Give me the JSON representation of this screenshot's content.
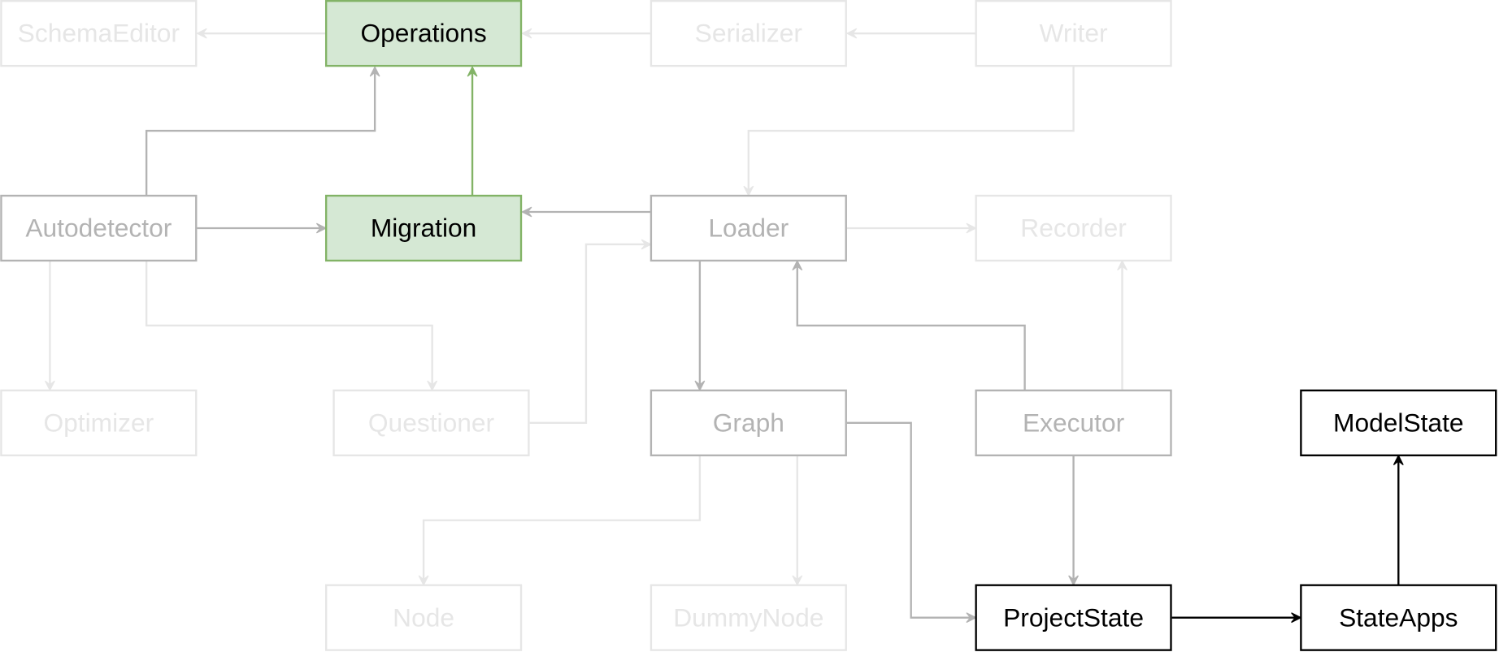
{
  "colors": {
    "faded_stroke": "#e6e6e6",
    "faded_text": "#e6e6e6",
    "medium_stroke": "#b3b3b3",
    "medium_text": "#b3b3b3",
    "green_fill": "#d5e8d4",
    "green_stroke": "#82b366",
    "black": "#000000"
  },
  "nodes": [
    {
      "id": "schemaeditor",
      "label": "SchemaEditor",
      "style": "faded"
    },
    {
      "id": "operations",
      "label": "Operations",
      "style": "green"
    },
    {
      "id": "serializer",
      "label": "Serializer",
      "style": "faded"
    },
    {
      "id": "writer",
      "label": "Writer",
      "style": "faded"
    },
    {
      "id": "autodetector",
      "label": "Autodetector",
      "style": "medium"
    },
    {
      "id": "migration",
      "label": "Migration",
      "style": "green"
    },
    {
      "id": "loader",
      "label": "Loader",
      "style": "medium"
    },
    {
      "id": "recorder",
      "label": "Recorder",
      "style": "faded"
    },
    {
      "id": "optimizer",
      "label": "Optimizer",
      "style": "faded"
    },
    {
      "id": "questioner",
      "label": "Questioner",
      "style": "faded"
    },
    {
      "id": "graph",
      "label": "Graph",
      "style": "medium"
    },
    {
      "id": "executor",
      "label": "Executor",
      "style": "medium"
    },
    {
      "id": "modelstate",
      "label": "ModelState",
      "style": "black"
    },
    {
      "id": "node",
      "label": "Node",
      "style": "faded"
    },
    {
      "id": "dummynode",
      "label": "DummyNode",
      "style": "faded"
    },
    {
      "id": "projectstate",
      "label": "ProjectState",
      "style": "black"
    },
    {
      "id": "stateapps",
      "label": "StateApps",
      "style": "black"
    }
  ],
  "edges": [
    {
      "from": "operations",
      "to": "schemaeditor",
      "style": "faded"
    },
    {
      "from": "serializer",
      "to": "operations",
      "style": "faded"
    },
    {
      "from": "writer",
      "to": "serializer",
      "style": "faded"
    },
    {
      "from": "autodetector",
      "to": "operations",
      "style": "medium"
    },
    {
      "from": "migration",
      "to": "operations",
      "style": "green"
    },
    {
      "from": "writer",
      "to": "loader",
      "style": "faded"
    },
    {
      "from": "autodetector",
      "to": "migration",
      "style": "medium"
    },
    {
      "from": "loader",
      "to": "migration",
      "style": "medium"
    },
    {
      "from": "loader",
      "to": "recorder",
      "style": "faded"
    },
    {
      "from": "autodetector",
      "to": "optimizer",
      "style": "faded"
    },
    {
      "from": "autodetector",
      "to": "questioner",
      "style": "faded"
    },
    {
      "from": "questioner",
      "to": "loader",
      "style": "faded"
    },
    {
      "from": "loader",
      "to": "graph",
      "style": "medium"
    },
    {
      "from": "executor",
      "to": "loader",
      "style": "medium"
    },
    {
      "from": "executor",
      "to": "recorder",
      "style": "faded"
    },
    {
      "from": "graph",
      "to": "node",
      "style": "faded"
    },
    {
      "from": "graph",
      "to": "dummynode",
      "style": "faded"
    },
    {
      "from": "graph",
      "to": "projectstate",
      "style": "medium"
    },
    {
      "from": "executor",
      "to": "projectstate",
      "style": "medium"
    },
    {
      "from": "projectstate",
      "to": "stateapps",
      "style": "black"
    },
    {
      "from": "stateapps",
      "to": "modelstate",
      "style": "black"
    }
  ]
}
